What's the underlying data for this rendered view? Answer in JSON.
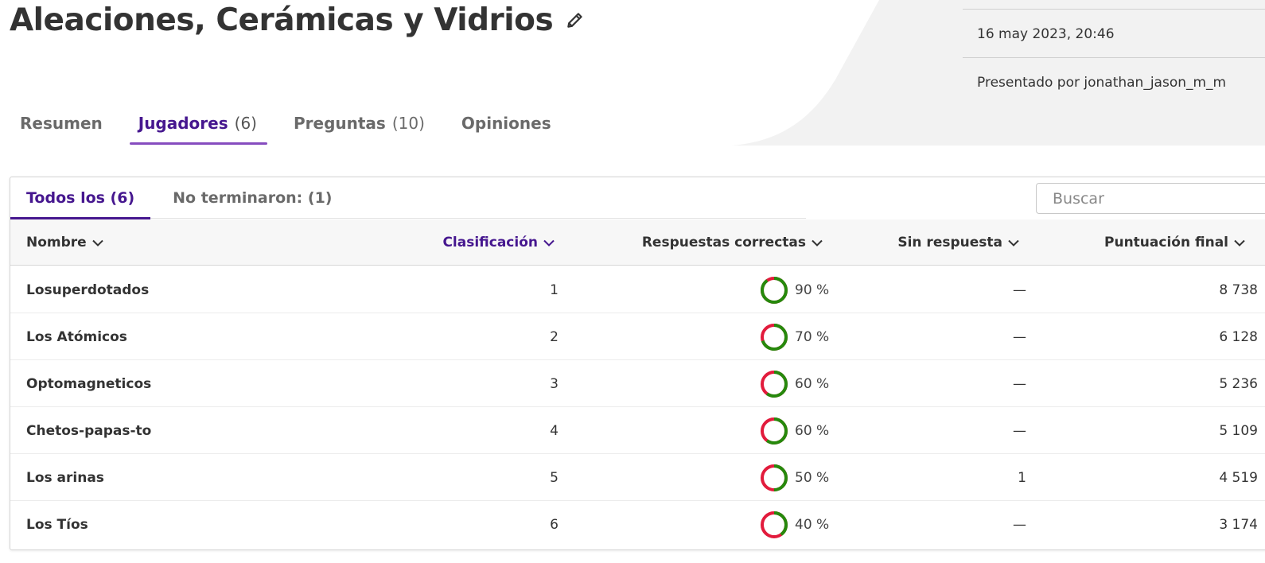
{
  "header": {
    "title": "Aleaciones, Cerámicas y Vidrios",
    "date": "16 may 2023, 20:46",
    "presented_by": "Presentado por jonathan_jason_m_m"
  },
  "tabs": [
    {
      "label": "Resumen",
      "count": ""
    },
    {
      "label": "Jugadores",
      "count": "(6)"
    },
    {
      "label": "Preguntas",
      "count": "(10)"
    },
    {
      "label": "Opiniones",
      "count": ""
    }
  ],
  "subtabs": {
    "all": "Todos los (6)",
    "unfinished": "No terminaron: (1)"
  },
  "search": {
    "placeholder": "Buscar"
  },
  "table": {
    "columns": {
      "name": "Nombre",
      "rank": "Clasificación",
      "correct": "Respuestas correctas",
      "unanswered": "Sin respuesta",
      "score": "Puntuación final"
    },
    "rows": [
      {
        "name": "Losuperdotados",
        "rank": "1",
        "correct_pct": 90,
        "correct_label": "90 %",
        "unanswered": "—",
        "score": "8 738"
      },
      {
        "name": "Los Atómicos",
        "rank": "2",
        "correct_pct": 70,
        "correct_label": "70 %",
        "unanswered": "—",
        "score": "6 128"
      },
      {
        "name": "Optomagneticos",
        "rank": "3",
        "correct_pct": 60,
        "correct_label": "60 %",
        "unanswered": "—",
        "score": "5 236"
      },
      {
        "name": "Chetos-papas-to",
        "rank": "4",
        "correct_pct": 60,
        "correct_label": "60 %",
        "unanswered": "—",
        "score": "5 109"
      },
      {
        "name": "Los arinas",
        "rank": "5",
        "correct_pct": 50,
        "correct_label": "50 %",
        "unanswered": "1",
        "score": "4 519"
      },
      {
        "name": "Los Tíos",
        "rank": "6",
        "correct_pct": 40,
        "correct_label": "40 %",
        "unanswered": "—",
        "score": "3 174"
      }
    ]
  },
  "colors": {
    "accent": "#46178f",
    "tab_underline": "#864cbf",
    "correct": "#26890c",
    "incorrect": "#e21b3c",
    "header_bg": "#f2f2f2"
  },
  "icons": {
    "edit": "pencil-icon",
    "sort": "chevron-down-icon"
  }
}
